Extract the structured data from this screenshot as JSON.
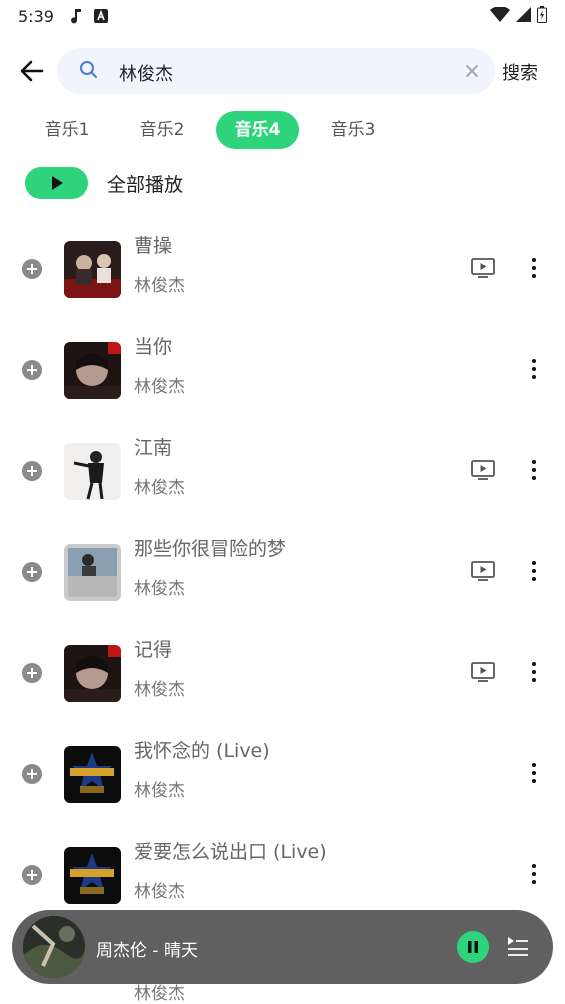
{
  "status_bar": {
    "time": "5:39",
    "icons": [
      "music-note-icon",
      "font-a-icon",
      "wifi-icon",
      "cellular-icon",
      "battery-icon"
    ]
  },
  "search": {
    "query": "林俊杰",
    "submit_label": "搜索"
  },
  "tabs": [
    {
      "label": "音乐1",
      "active": false
    },
    {
      "label": "音乐2",
      "active": false
    },
    {
      "label": "音乐4",
      "active": true
    },
    {
      "label": "音乐3",
      "active": false
    }
  ],
  "play_all": {
    "label": "全部播放"
  },
  "songs": [
    {
      "title": "曹操",
      "artist": "林俊杰",
      "has_mv": true
    },
    {
      "title": "当你",
      "artist": "林俊杰",
      "has_mv": false
    },
    {
      "title": "江南",
      "artist": "林俊杰",
      "has_mv": true
    },
    {
      "title": "那些你很冒险的梦",
      "artist": "林俊杰",
      "has_mv": true
    },
    {
      "title": "记得",
      "artist": "林俊杰",
      "has_mv": true
    },
    {
      "title": "我怀念的 (Live)",
      "artist": "林俊杰",
      "has_mv": false
    },
    {
      "title": "爱要怎么说出口 (Live)",
      "artist": "林俊杰",
      "has_mv": false
    }
  ],
  "partially_hidden_artist": "林俊杰",
  "now_playing": {
    "text": "周杰伦 - 晴天"
  },
  "colors": {
    "accent": "#2dd47c",
    "player_bg": "#606060",
    "search_bg": "#f1f4fb"
  }
}
